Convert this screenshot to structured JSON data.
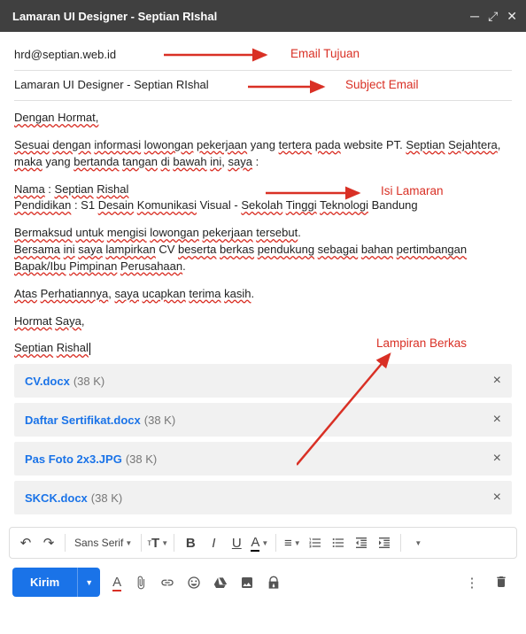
{
  "header": {
    "title": "Lamaran UI Designer - Septian RIshal"
  },
  "fields": {
    "to": "hrd@septian.web.id",
    "subject": "Lamaran UI Designer - Septian RIshal"
  },
  "body": {
    "greeting": "Dengan Hormat,",
    "intro_a": "Sesuai dengan informasi lowongan pekerjaan yang tertera pada website PT. Septian Sejahtera, maka yang bertanda tangan di bawah ini, saya :",
    "name_line": "Nama : Septian Rishal",
    "edu_line": "Pendidikan : S1 Desain Komunikasi Visual - Sekolah Tinggi Teknologi Bandung",
    "p2_a": "Bermaksud untuk mengisi lowongan pekerjaan tersebut.",
    "p2_b": "Bersama ini saya lampirkan CV beserta berkas pendukung sebagai bahan pertimbangan Bapak/Ibu Pimpinan Perusahaan.",
    "thanks": "Atas Perhatiannya, saya ucapkan terima kasih.",
    "closing": "Hormat Saya,",
    "signature": "Septian Rishal"
  },
  "attachments": [
    {
      "name": "CV.docx",
      "size": "(38 K)"
    },
    {
      "name": "Daftar Sertifikat.docx",
      "size": "(38 K)"
    },
    {
      "name": "Pas Foto 2x3.JPG",
      "size": "(38 K)"
    },
    {
      "name": "SKCK.docx",
      "size": "(38 K)"
    }
  ],
  "toolbar": {
    "font": "Sans Serif"
  },
  "actions": {
    "send": "Kirim"
  },
  "annotations": {
    "to": "Email Tujuan",
    "subject": "Subject Email",
    "body": "Isi Lamaran",
    "attach": "Lampiran Berkas"
  }
}
